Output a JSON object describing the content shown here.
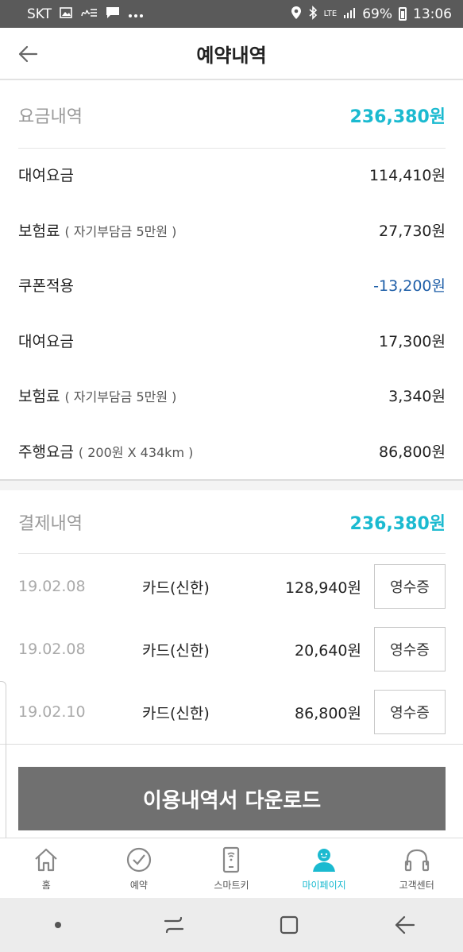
{
  "status_bar": {
    "carrier": "SKT",
    "network": "LTE",
    "battery": "69%",
    "time": "13:06"
  },
  "header": {
    "title": "예약내역"
  },
  "fee_section": {
    "title": "요금내역",
    "total": "236,380원",
    "items": [
      {
        "label": "대여요금",
        "note": "",
        "amount": "114,410원"
      },
      {
        "label": "보험료",
        "note": "( 자기부담금 5만원 )",
        "amount": "27,730원"
      },
      {
        "label": "쿠폰적용",
        "note": "",
        "amount": "-13,200원"
      },
      {
        "label": "대여요금",
        "note": "",
        "amount": "17,300원"
      },
      {
        "label": "보험료",
        "note": "( 자기부담금 5만원 )",
        "amount": "3,340원"
      },
      {
        "label": "주행요금",
        "note": "( 200원 X 434km )",
        "amount": "86,800원"
      }
    ]
  },
  "payment_section": {
    "title": "결제내역",
    "total": "236,380원",
    "rows": [
      {
        "date": "19.02.08",
        "method": "카드(신한)",
        "amount": "128,940원",
        "receipt": "영수증"
      },
      {
        "date": "19.02.08",
        "method": "카드(신한)",
        "amount": "20,640원",
        "receipt": "영수증"
      },
      {
        "date": "19.02.10",
        "method": "카드(신한)",
        "amount": "86,800원",
        "receipt": "영수증"
      }
    ]
  },
  "download_button": "이용내역서 다운로드",
  "tabs": [
    {
      "label": "홈",
      "icon": "home-icon"
    },
    {
      "label": "예약",
      "icon": "clock-icon"
    },
    {
      "label": "스마트키",
      "icon": "smartkey-icon"
    },
    {
      "label": "마이페이지",
      "icon": "person-icon"
    },
    {
      "label": "고객센터",
      "icon": "headset-icon"
    }
  ],
  "colors": {
    "accent": "#1bbad0",
    "negative": "#1f5fa8",
    "button": "#707070"
  }
}
